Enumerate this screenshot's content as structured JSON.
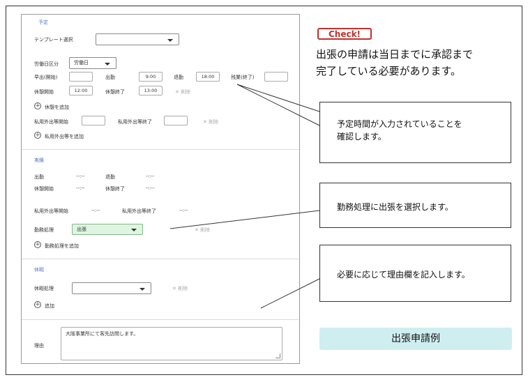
{
  "yotei": {
    "section_title": "予定",
    "template_label": "テンプレート選択",
    "template_value": "",
    "kubun_label": "労働日区分",
    "kubun_value": "労働日",
    "hayade_label": "早出(開始)",
    "hayade_value": "",
    "shukkin_label": "出勤",
    "shukkin_value": "9:00",
    "taikin_label": "退勤",
    "taikin_value": "18:00",
    "zangyo_label": "残業(終了)",
    "zangyo_value": "",
    "kyukei_start_label": "休憩開始",
    "kyukei_start_value": "12:00",
    "kyukei_end_label": "休憩終了",
    "kyukei_end_value": "13:00",
    "delete_label": "削除",
    "add_break_label": "休憩を追加",
    "shiyo_start_label": "私用外出等開始",
    "shiyo_start_value": "",
    "shiyo_end_label": "私用外出等終了",
    "shiyo_end_value": "",
    "delete_label2": "削除",
    "add_shiyo_label": "私用外出等を追加"
  },
  "jisseki": {
    "section_title": "実績",
    "shukkin_label": "出勤",
    "shukkin_value": "--:--",
    "taikin_label": "退勤",
    "taikin_value": "--:--",
    "kyukei_start_label": "休憩開始",
    "kyukei_start_value": "--:--",
    "kyukei_end_label": "休憩終了",
    "kyukei_end_value": "--:--",
    "shiyo_start_label": "私用外出等開始",
    "shiyo_start_value": "--:--",
    "shiyo_end_label": "私用外出等終了",
    "shiyo_end_value": "--:--",
    "kinmu_label": "勤務処理",
    "kinmu_value": "出張",
    "delete_label": "削除",
    "add_kinmu_label": "勤務処理を追加"
  },
  "kyuka": {
    "section_title": "休暇",
    "kyuka_label": "休暇処理",
    "kyuka_value": "",
    "delete_label": "削除",
    "add_label": "追加"
  },
  "riyu": {
    "label": "理由",
    "value": "大阪事業所にて客先訪問します。"
  },
  "annotations": {
    "check_badge": "Check!",
    "note_line1": "出張の申請は当日までに承認まで",
    "note_line2": "完了している必要があります。",
    "callout1_line1": "予定時間が入力されていることを",
    "callout1_line2": "確認します。",
    "callout2": "勤務処理に出張を選択します。",
    "callout3": "必要に応じて理由欄を記入します。",
    "example_label": "出張申請例"
  },
  "colors": {
    "check_red": "#c0302a",
    "section_blue": "#5577cc",
    "selected_green": "#dff5e1",
    "example_bg": "#cfeef0"
  }
}
